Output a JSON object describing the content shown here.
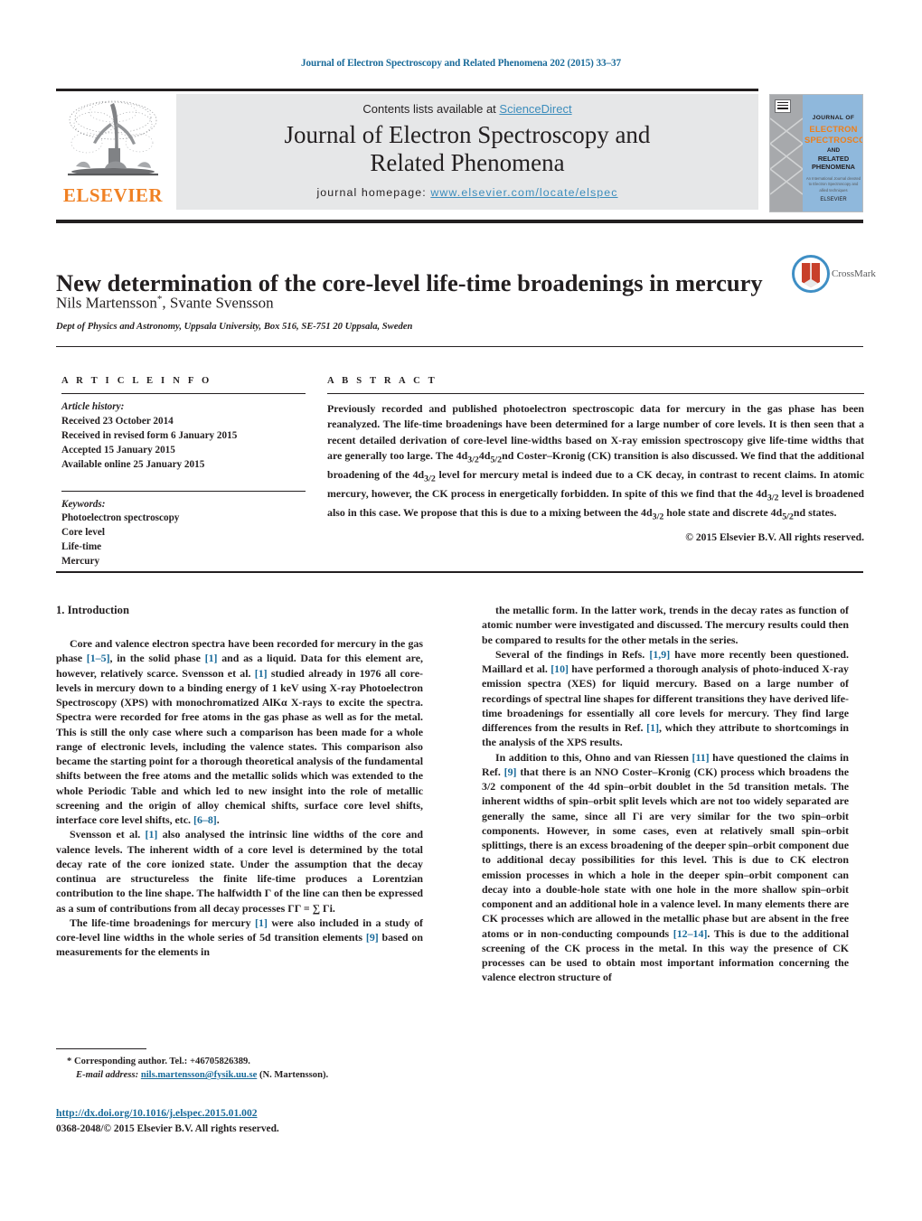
{
  "running_head": "Journal of Electron Spectroscopy and Related Phenomena 202 (2015) 33–37",
  "masthead": {
    "contents_prefix": "Contents lists available at ",
    "sciencedirect": "ScienceDirect",
    "journal_title_line1": "Journal of Electron Spectroscopy and",
    "journal_title_line2": "Related Phenomena",
    "homepage_prefix": "journal homepage: ",
    "homepage_url": "www.elsevier.com/locate/elspec",
    "publisher": "ELSEVIER"
  },
  "cover": {
    "line1": "JOURNAL OF",
    "line2": "ELECTRON",
    "line3": "SPECTROSCOPY",
    "line4": "AND",
    "line5": "RELATED PHENOMENA",
    "footer_small": "An International Journal devoted to Electron Spectroscopy and allied techniques",
    "footer_brand": "ELSEVIER"
  },
  "article": {
    "title": "New determination of the core-level life-time broadenings in mercury",
    "authors": "Nils Martensson",
    "authors_corresponding_mark": "*",
    "authors_rest": ", Svante Svensson",
    "affiliation": "Dept of Physics and Astronomy, Uppsala University, Box 516, SE-751 20 Uppsala, Sweden",
    "crossmark_label": "CrossMark"
  },
  "article_info": {
    "heading": "A R T I C L E    I N F O",
    "history_label": "Article history:",
    "history": [
      "Received 23 October 2014",
      "Received in revised form 6 January 2015",
      "Accepted 15 January 2015",
      "Available online 25 January 2015"
    ],
    "keywords_label": "Keywords:",
    "keywords": [
      "Photoelectron spectroscopy",
      "Core level",
      "Life-time",
      "Mercury"
    ]
  },
  "abstract": {
    "heading": "A B S T R A C T",
    "text": "Previously recorded and published photoelectron spectroscopic data for mercury in the gas phase has been reanalyzed. The life-time broadenings have been determined for a large number of core levels. It is then seen that a recent detailed derivation of core-level line-widths based on X-ray emission spectroscopy give life-time widths that are generally too large. The 4d3/24d5/2nd Coster–Kronig (CK) transition is also discussed. We find that the additional broadening of the 4d3/2 level for mercury metal is indeed due to a CK decay, in contrast to recent claims. In atomic mercury, however, the CK process in energetically forbidden. In spite of this we find that the 4d3/2 level is broadened also in this case. We propose that this is due to a mixing between the 4d3/2 hole state and discrete 4d5/2nd states.",
    "copyright": "© 2015 Elsevier B.V. All rights reserved."
  },
  "body": {
    "section_heading": "1.  Introduction",
    "left_paragraphs": [
      "Core and valence electron spectra have been recorded for mercury in the gas phase [1–5], in the solid phase [1] and as a liquid. Data for this element are, however, relatively scarce. Svensson et al. [1] studied already in 1976 all core-levels in mercury down to a binding energy of 1 keV using X-ray Photoelectron Spectroscopy (XPS) with monochromatized AlKα X-rays to excite the spectra. Spectra were recorded for free atoms in the gas phase as well as for the metal. This is still the only case where such a comparison has been made for a whole range of electronic levels, including the valence states. This comparison also became the starting point for a thorough theoretical analysis of the fundamental shifts between the free atoms and the metallic solids which was extended to the whole Periodic Table and which led to new insight into the role of metallic screening and the origin of alloy chemical shifts, surface core level shifts, interface core level shifts, etc. [6–8].",
      "Svensson et al. [1] also analysed the intrinsic line widths of the core and valence levels. The inherent width of a core level is determined by the total decay rate of the core ionized state. Under the assumption that the decay continua are structureless the finite life-time produces a Lorentzian contribution to the line shape. The halfwidth Γ of the line can then be expressed as a sum of contributions from all decay processes ΓΓ = ∑ Γi.",
      "The life-time broadenings for mercury [1] were also included in a study of core-level line widths in the whole series of 5d transition elements [9] based on measurements for the elements in"
    ],
    "right_paragraphs": [
      "the metallic form. In the latter work, trends in the decay rates as function of atomic number were investigated and discussed. The mercury results could then be compared to results for the other metals in the series.",
      "Several of the findings in Refs. [1,9] have more recently been questioned. Maillard et al. [10] have performed a thorough analysis of photo-induced X-ray emission spectra (XES) for liquid mercury. Based on a large number of recordings of spectral line shapes for different transitions they have derived life-time broadenings for essentially all core levels for mercury. They find large differences from the results in Ref. [1], which they attribute to shortcomings in the analysis of the XPS results.",
      "In addition to this, Ohno and van Riessen [11] have questioned the claims in Ref. [9] that there is an NNO Coster–Kronig (CK) process which broadens the 3/2 component of the 4d spin–orbit doublet in the 5d transition metals. The inherent widths of spin–orbit split levels which are not too widely separated are generally the same, since all Γi are very similar for the two spin–orbit components. However, in some cases, even at relatively small spin–orbit splittings, there is an excess broadening of the deeper spin–orbit component due to additional decay possibilities for this level. This is due to CK electron emission processes in which a hole in the deeper spin–orbit component can decay into a double-hole state with one hole in the more shallow spin–orbit component and an additional hole in a valence level. In many elements there are CK processes which are allowed in the metallic phase but are absent in the free atoms or in non-conducting compounds [12–14]. This is due to the additional screening of the CK process in the metal. In this way the presence of CK processes can be used to obtain most important information concerning the valence electron structure of"
    ]
  },
  "footer": {
    "corresponding": "* Corresponding author. Tel.: +46705826389.",
    "email_label": "E-mail address:",
    "email": "nils.martensson@fysik.uu.se",
    "email_suffix": "(N. Martensson).",
    "doi": "http://dx.doi.org/10.1016/j.elspec.2015.01.002",
    "issn_line": "0368-2048/© 2015 Elsevier B.V. All rights reserved."
  },
  "colors": {
    "link": "#1a6b9a",
    "sciencedirect": "#3c8dbc",
    "elsevier_orange": "#f08124",
    "banner_bg": "#e6e7e8",
    "cover_blue": "#8fb8dc",
    "crossmark_blue": "#3f8fc5",
    "crossmark_red": "#c8402b"
  }
}
